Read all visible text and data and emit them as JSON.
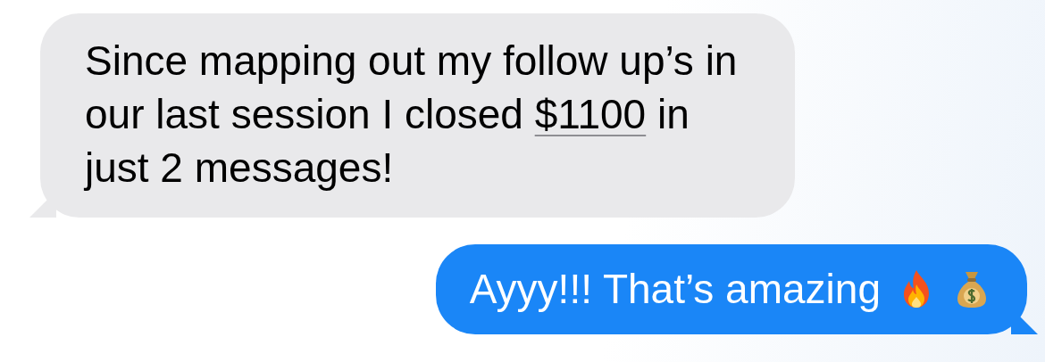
{
  "messages": [
    {
      "kind": "received",
      "text_before": "Since mapping out my follow up’s in our last session I closed ",
      "link": "$1100",
      "text_after": " in just 2 messages!"
    },
    {
      "kind": "sent",
      "text": "Ayyy!!! That’s amazing"
    }
  ]
}
